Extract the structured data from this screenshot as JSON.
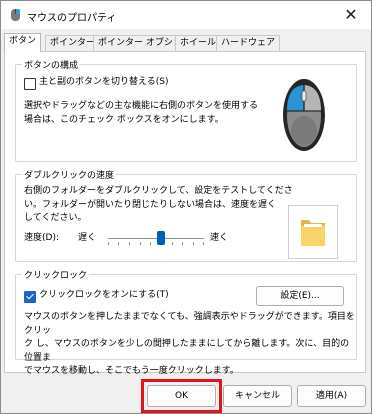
{
  "window": {
    "title": "マウスのプロパティ",
    "close_glyph": "✕"
  },
  "tabs": [
    {
      "label": "ボタン",
      "active": true
    },
    {
      "label": "ポインター",
      "active": false
    },
    {
      "label": "ポインター オプション",
      "active": false
    },
    {
      "label": "ホイール",
      "active": false
    },
    {
      "label": "ハードウェア",
      "active": false
    }
  ],
  "button_config": {
    "title": "ボタンの構成",
    "swap_label": "主と副のボタンを切り替える(S)",
    "swap_checked": false,
    "description": "選択やドラッグなどの主な機能に右側のボタンを使用する\n場合は、このチェック ボックスをオンにします。"
  },
  "double_click": {
    "title": "ダブルクリックの速度",
    "description": "右側のフォルダーをダブルクリックして、設定をテストしてくださ\nい。フォルダーが開いたり閉じたりしない場合は、速度を遅く\nしてください。",
    "speed_label": "速度(D):",
    "slow_label": "遅く",
    "fast_label": "速く",
    "speed_value_fraction": 0.55
  },
  "click_lock": {
    "title": "クリックロック",
    "enable_label": "クリックロックをオンにする(T)",
    "enable_checked": true,
    "settings_button": "設定(E)...",
    "description": "マウスのボタンを押したままでなくても、強調表示やドラッグができます。項目をクリッ\nク し、マウスのボタンを少しの間押したままにしてから離します。次に、目的の位置ま\nでマウスを移動し、そこでもう一度クリックします。"
  },
  "footer": {
    "ok": "OK",
    "cancel": "キャンセル",
    "apply": "適用(A)"
  },
  "colors": {
    "accent": "#005fb8",
    "highlight": "#e0121a"
  }
}
